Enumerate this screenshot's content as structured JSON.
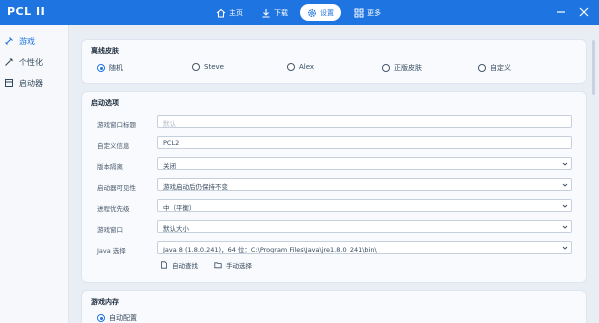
{
  "app": {
    "title": "PCL II"
  },
  "nav": [
    {
      "label": "主页",
      "icon": "home-icon"
    },
    {
      "label": "下载",
      "icon": "download-icon"
    },
    {
      "label": "设置",
      "icon": "settings-gear-icon",
      "active": true
    },
    {
      "label": "更多",
      "icon": "grid-icon"
    }
  ],
  "sidebar": {
    "items": [
      {
        "label": "游戏",
        "icon": "game-icon",
        "active": true
      },
      {
        "label": "个性化",
        "icon": "personalize-icon"
      },
      {
        "label": "启动器",
        "icon": "launcher-icon"
      }
    ]
  },
  "offline_skin": {
    "title": "离线皮肤",
    "options": [
      "随机",
      "Steve",
      "Alex",
      "正版皮肤",
      "自定义"
    ],
    "selected": "随机"
  },
  "launch_options": {
    "title": "启动选项",
    "rows": [
      {
        "label": "游戏窗口标题",
        "value": "",
        "placeholder": "默认",
        "type": "text"
      },
      {
        "label": "自定义信息",
        "value": "PCL2",
        "type": "text"
      },
      {
        "label": "版本隔离",
        "value": "关闭",
        "type": "select"
      },
      {
        "label": "启动器可见性",
        "value": "游戏启动后仍保持不变",
        "type": "select"
      },
      {
        "label": "进程优先级",
        "value": "中（平衡）",
        "type": "select"
      },
      {
        "label": "游戏窗口",
        "value": "默认大小",
        "type": "select"
      },
      {
        "label": "Java 选择",
        "value": "Java 8 (1.8.0.241)，64 位：C:\\Program Files\\Java\\jre1.8.0_241\\bin\\",
        "type": "select"
      }
    ],
    "auto_find_label": "自动查找",
    "manual_select_label": "手动选择"
  },
  "game_memory": {
    "title": "游戏内存",
    "option_label": "自动配置"
  },
  "colors": {
    "accent": "#1e74e0",
    "background": "#e9eef5"
  }
}
